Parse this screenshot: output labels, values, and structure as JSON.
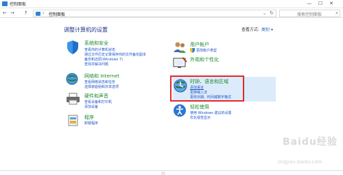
{
  "window": {
    "title": "控制面板",
    "minimize": "—",
    "maximize": "☐",
    "close": "✕"
  },
  "nav": {
    "back": "←",
    "forward": "→",
    "up": "↑",
    "address_sep": "›",
    "breadcrumb": "控制面板",
    "dropdown": "⌄",
    "refresh": "↻",
    "search_placeholder": "搜索控制面板",
    "search_icon": "⌕"
  },
  "page": {
    "heading": "调整计算机的设置",
    "view_by_label": "查看方式:",
    "view_by_value": "类别 ▾"
  },
  "categories_left": [
    {
      "title": "系统和安全",
      "icon": "shield-icon",
      "links": [
        "查看你的计算机状态",
        "通过文件历史记录保存你的文件备份副本",
        "备份和还原(Windows 7)",
        "查找并解决问题"
      ]
    },
    {
      "title": "网络和 Internet",
      "icon": "network-globe-icon",
      "links": [
        "查看网络状态和任务",
        "选择家庭组和共享选项"
      ]
    },
    {
      "title": "硬件和声音",
      "icon": "printer-icon",
      "links": [
        "查看设备和打印机",
        "添加设备"
      ]
    },
    {
      "title": "程序",
      "icon": "programs-icon",
      "links": [
        "卸载程序"
      ]
    }
  ],
  "categories_right": [
    {
      "title": "用户帐户",
      "icon": "users-icon",
      "links": [
        "更改帐户类型"
      ]
    },
    {
      "title": "外观和个性化",
      "icon": "appearance-icon",
      "links": []
    },
    {
      "title": "时钟、语言和区域",
      "icon": "clock-globe-icon",
      "links": [
        "添加语言",
        "更换输入法",
        "更改日期、时间或数字格式"
      ]
    },
    {
      "title": "轻松使用",
      "icon": "ease-of-access-icon",
      "links": [
        "使用 Windows 建议的设置",
        "优化视觉显示"
      ]
    }
  ],
  "watermark": {
    "logo": "Baidu经验",
    "url": "jingyan.baidu.com"
  },
  "colors": {
    "category_title": "#1a8a2e",
    "link": "#1a52c9",
    "heading": "#1e3287",
    "highlight_border": "#e3262b"
  }
}
